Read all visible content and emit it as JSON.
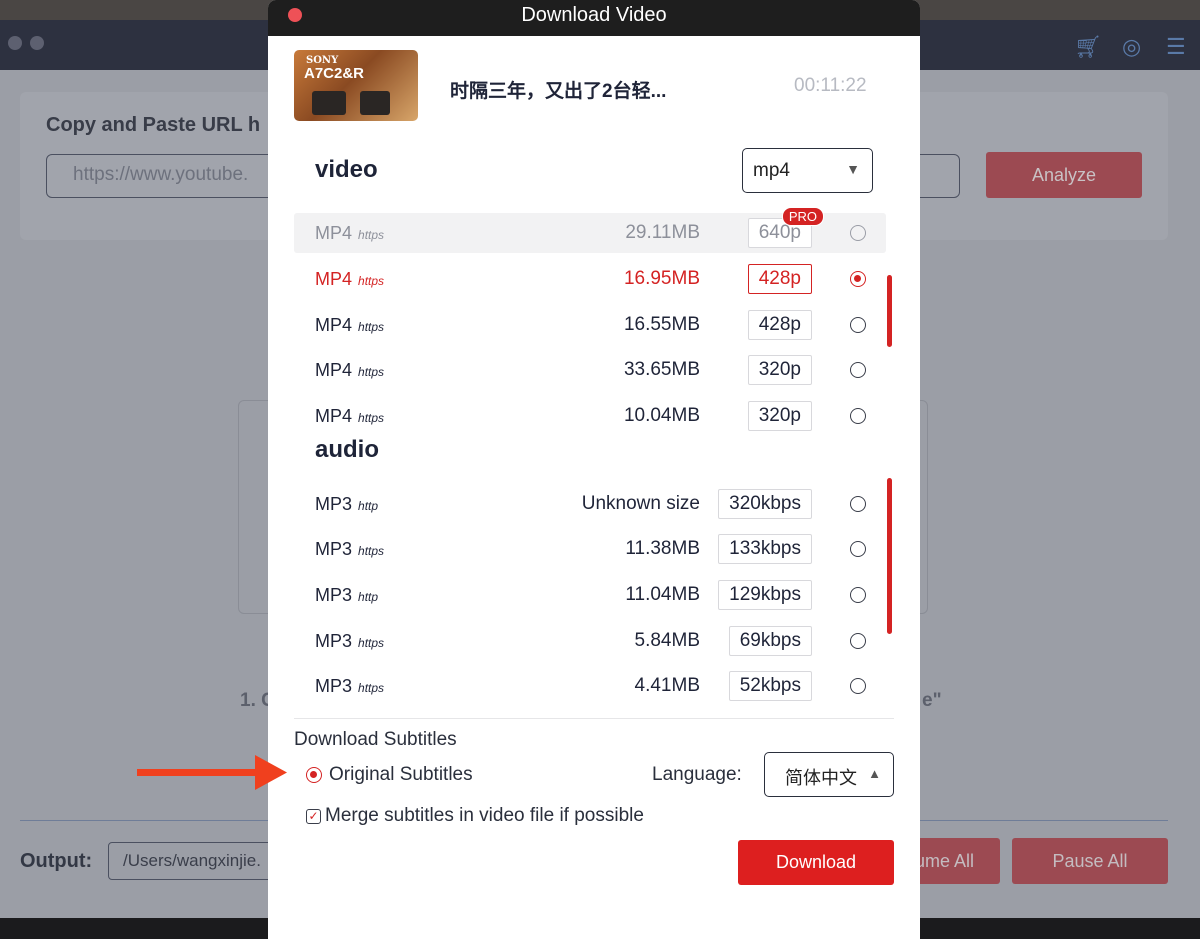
{
  "app": {
    "url_title": "Copy and Paste URL h",
    "url_placeholder": "https://www.youtube.",
    "analyze_label": "Analyze",
    "hint_left": "1. C",
    "hint_right": "e\"",
    "output_label": "Output:",
    "output_path": "/Users/wangxinjie.",
    "resume_all_label": "ume All",
    "pause_all_label": "Pause All"
  },
  "dialog": {
    "title": "Download Video",
    "thumbnail": {
      "brand": "SONY",
      "model": "A7C2&R"
    },
    "video_title": "时隔三年，又出了2台轻...",
    "duration": "00:11:22",
    "video_section": "video",
    "format_select": "mp4",
    "video_rows": [
      {
        "format": "MP4",
        "protocol": "https",
        "size": "29.11MB",
        "quality": "640p",
        "pro": "PRO",
        "state": "hover"
      },
      {
        "format": "MP4",
        "protocol": "https",
        "size": "16.95MB",
        "quality": "428p",
        "state": "selected"
      },
      {
        "format": "MP4",
        "protocol": "https",
        "size": "16.55MB",
        "quality": "428p",
        "state": ""
      },
      {
        "format": "MP4",
        "protocol": "https",
        "size": "33.65MB",
        "quality": "320p",
        "state": ""
      },
      {
        "format": "MP4",
        "protocol": "https",
        "size": "10.04MB",
        "quality": "320p",
        "state": ""
      }
    ],
    "audio_section": "audio",
    "audio_rows": [
      {
        "format": "MP3",
        "protocol": "http",
        "size": "Unknown size",
        "quality": "320kbps"
      },
      {
        "format": "MP3",
        "protocol": "https",
        "size": "11.38MB",
        "quality": "133kbps"
      },
      {
        "format": "MP3",
        "protocol": "http",
        "size": "11.04MB",
        "quality": "129kbps"
      },
      {
        "format": "MP3",
        "protocol": "https",
        "size": "5.84MB",
        "quality": "69kbps"
      },
      {
        "format": "MP3",
        "protocol": "https",
        "size": "4.41MB",
        "quality": "52kbps"
      }
    ],
    "subtitles": {
      "heading": "Download Subtitles",
      "original_label": "Original Subtitles",
      "original_selected": true,
      "language_label": "Language:",
      "language_value": "简体中文",
      "merge_label": "Merge subtitles in video file if possible",
      "merge_checked": true
    },
    "download_label": "Download"
  },
  "colors": {
    "accent": "#dd1f1f",
    "annotation_arrow": "#f0401e"
  }
}
